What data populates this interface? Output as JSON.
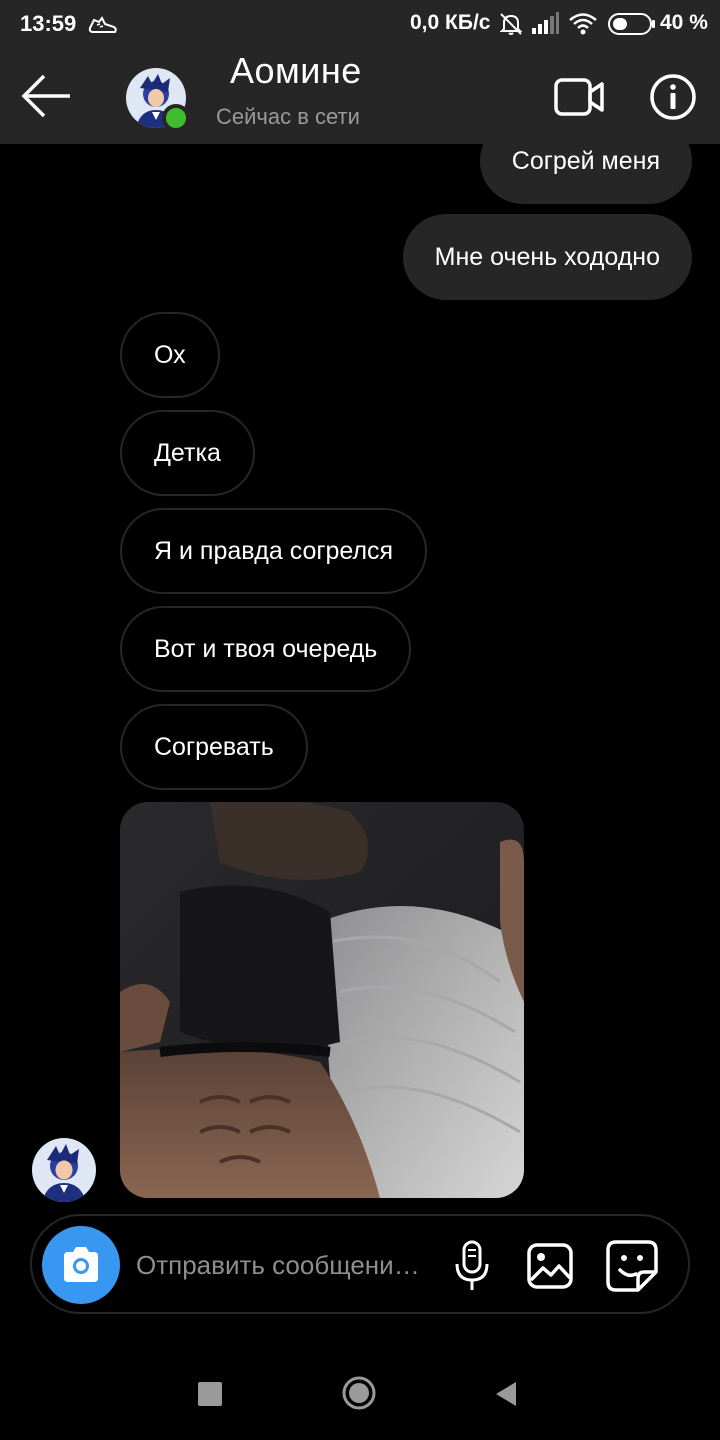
{
  "status_bar": {
    "time": "13:59",
    "network_speed": "0,0 КБ/с",
    "battery_percent": "40 %",
    "icons": [
      "sneaker-icon",
      "bell-off-icon",
      "signal-icon",
      "wifi-icon",
      "battery-icon"
    ]
  },
  "header": {
    "contact_name": "Аомине",
    "presence": "Сейчас в сети",
    "online": true,
    "icons": [
      "back-arrow-icon",
      "video-call-icon",
      "info-icon"
    ]
  },
  "messages": {
    "outgoing": [
      {
        "text": "Согрей меня"
      },
      {
        "text": "Мне очень хододно"
      }
    ],
    "incoming": [
      {
        "text": "Ох"
      },
      {
        "text": "Детка"
      },
      {
        "text": "Я и правда согрелся"
      },
      {
        "text": "Вот и твоя очередь"
      },
      {
        "text": "Согревать"
      }
    ]
  },
  "composer": {
    "placeholder": "Отправить сообщени…",
    "icons": [
      "camera-icon",
      "microphone-icon",
      "gallery-icon",
      "sticker-icon"
    ]
  },
  "colors": {
    "background": "#000000",
    "bar": "#262626",
    "accent": "#3897f0",
    "online": "#3fbd2e",
    "secondary_text": "#9a9a9a"
  },
  "navbar": {
    "icons": [
      "recents-square-icon",
      "home-circle-icon",
      "back-triangle-icon"
    ]
  }
}
